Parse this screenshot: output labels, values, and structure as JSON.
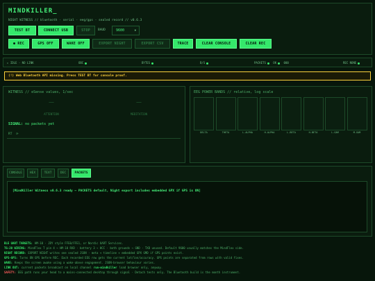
{
  "app": {
    "title": "MINDKILLER_",
    "subtitle": "NIGHT WITNESS // bluetooth · serial · eeg/gps · sealed record // v0.6.3"
  },
  "toolbar1": {
    "test_bt": "TEST BT",
    "connect_usb": "CONNECT USB",
    "stop": "STOP",
    "baud_label": "BAUD",
    "baud_value": "9600"
  },
  "toolbar2": {
    "rec": "● REC",
    "gps_off": "GPS OFF",
    "wake_off": "WAKE OFF",
    "export_night": "EXPORT NIGHT",
    "export_csv": "EXPORT CSV",
    "trace": "TRACE",
    "clear_console": "CLEAR CONSOLE",
    "clear_rec": "CLEAR REC"
  },
  "status_bar": {
    "mode": "▸ IDLE · NO LINK",
    "obc": "OBC",
    "bytes": "BYTES",
    "bs": "B/S",
    "packets": "PACKETS",
    "ok": "OK",
    "rate": "000",
    "rec_none": "REC NONE"
  },
  "warning": "(!) Web Bluetooth API missing. Press TEST BT for console proof.",
  "witness": {
    "title": "WITNESS // eSense values, 1/sec",
    "attention_value": "——",
    "attention_label": "ATTENTION",
    "meditation_value": "——",
    "meditation_label": "MEDITATION",
    "signal_label": "SIGNAL:",
    "signal_value": "no packets yet",
    "rt_label": "RT"
  },
  "eeg": {
    "title": "EEG POWER BANDS // relative, log scale",
    "bands": [
      "DELTA",
      "THETA",
      "L-ALPHA",
      "H-ALPHA",
      "L-BETA",
      "H-BETA",
      "L-GAM",
      "M-GAM"
    ],
    "levels": [
      0,
      0,
      0,
      0,
      0,
      0,
      0,
      0
    ]
  },
  "tabs": [
    "CONSOLE",
    "HEX",
    "TEXT",
    "DEC",
    "PACKETS"
  ],
  "console": {
    "text": "[MindKiller Witness v0.6.3 ready — PACKETS default, Night export includes embedded GPX if GPS is ON]"
  },
  "footer": [
    {
      "key": "BLE UART TARGETS:",
      "text": "HM-10 · JDY style FFE0/FFE1, or Nordic UART Services."
    },
    {
      "key": "TG-20 WIRING:",
      "text": "MindFlex T pin 4 → HM-10 RXD · battery 3 → HCC · both grounds → GND · TXD unused. Default 9600 usually matches the MindFlex side."
    },
    {
      "key": "NIGHT RECORD:",
      "text": "EXPORT NIGHT writes one sealed JSON · meta + timeline + embedded GPX GMD if GPS points exist."
    },
    {
      "key": "GPS-GPS:",
      "text": "Turns ON GPS before REC. Each recorded EEG row gets the current lat/lon/accuracy. GPS points are separated from rows with valid fixes."
    },
    {
      "key": "WAKE:",
      "text": "Keeps the screen awake using a wake-above engagement. JSON-browser behaviour varies."
    },
    {
      "key": "LINK OUT:",
      "text": "current packets broadcast on local channel",
      "strong": "run-mindkiller",
      "tail": "load browser only, anyway."
    },
    {
      "key": "SAFETY:",
      "text": "EEG path runs your head to a mains-connected desktop through signal · Detach tests only. The Bluetooth build is the month instrument.",
      "warn": true
    }
  ],
  "colors": {
    "accent": "#35e86b",
    "background": "#07160b",
    "warning": "#ffd23c",
    "danger": "#ff5c5c"
  }
}
